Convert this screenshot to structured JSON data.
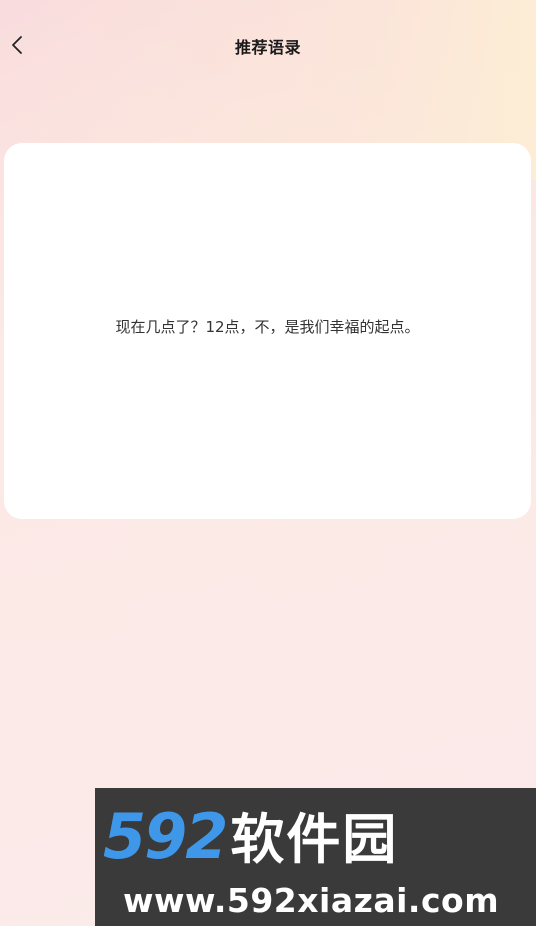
{
  "header": {
    "back_icon": "chevron-left-icon",
    "title": "推荐语录"
  },
  "quote": {
    "text": "现在几点了？12点，不，是我们幸福的起点。"
  },
  "watermark": {
    "number": "592",
    "name": "软件园",
    "url": "www.592xiazai.com"
  },
  "colors": {
    "card": "#ffffff",
    "title": "#1a1a1a",
    "watermark_bg": "#3a3a3a",
    "watermark_accent": "#3f97ea"
  }
}
